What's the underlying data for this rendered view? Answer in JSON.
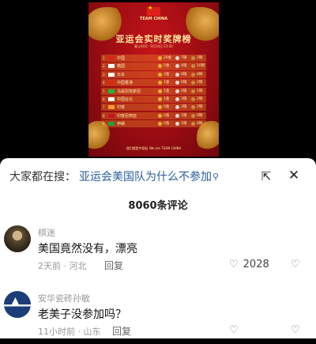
{
  "poster": {
    "team_label": "TEAM CHINA",
    "title": "亚运会实时奖牌榜",
    "subtitle": "截止时间：9月24日 23:00",
    "footer": "我们都是中国队 We are TEAM CHINA",
    "rows": [
      {
        "rank": "1",
        "country": "中国",
        "flag_color": "#e0201a",
        "gold": "20金",
        "silver": "7银",
        "bronze": "2铜"
      },
      {
        "rank": "2",
        "country": "韩国",
        "flag_color": "#ffffff",
        "gold": "5金",
        "silver": "4银",
        "bronze": "10铜"
      },
      {
        "rank": "3",
        "country": "日本",
        "flag_color": "#ffffff",
        "gold": "3金",
        "silver": "8银",
        "bronze": "8铜"
      },
      {
        "rank": "4",
        "country": "中国香港",
        "flag_color": "#de2910",
        "gold": "1金",
        "silver": "0银",
        "bronze": "2铜"
      },
      {
        "rank": "5",
        "country": "乌兹别克斯坦",
        "flag_color": "#1eb53a",
        "gold": "1金",
        "silver": "0银",
        "bronze": "1铜"
      },
      {
        "rank": "6",
        "country": "中国台北",
        "flag_color": "#ffffff",
        "gold": "1金",
        "silver": "3银",
        "bronze": "2铜"
      },
      {
        "rank": "7",
        "country": "印度",
        "flag_color": "#ff9933",
        "gold": "0金",
        "silver": "3银",
        "bronze": "2铜"
      },
      {
        "rank": "8",
        "country": "印度尼西亚",
        "flag_color": "#ce1126",
        "gold": "0金",
        "silver": "1银",
        "bronze": "0铜"
      },
      {
        "rank": "9",
        "country": "伊朗",
        "flag_color": "#239f40",
        "gold": "0金",
        "silver": "1银",
        "bronze": "0铜"
      }
    ]
  },
  "search": {
    "prefix": "大家都在搜：",
    "query": "亚运会美国队为什么不参加"
  },
  "comment_count": "8060条评论",
  "comments": [
    {
      "username": "棋迷",
      "text": "美国竟然没有，漂亮",
      "meta": "2天前 · 河北",
      "reply_label": "回复",
      "likes": "2028"
    },
    {
      "username": "安华瓷砖孙敏",
      "text": "老美子没参加吗？",
      "meta": "11小时前 · 山东",
      "reply_label": "回复",
      "likes": ""
    }
  ],
  "colors": {
    "link": "#2a5d9e",
    "poster_red": "#c3141b",
    "gold": "#e9b43a"
  }
}
